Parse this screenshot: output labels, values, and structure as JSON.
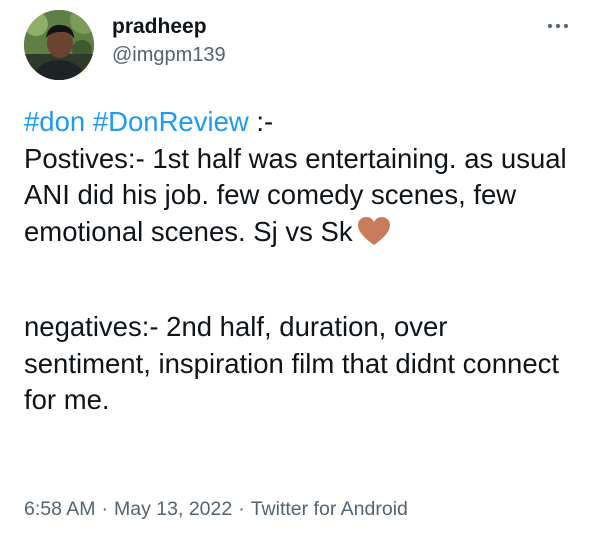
{
  "user": {
    "display_name": "pradheep",
    "handle": "@imgpm139",
    "avatar_icon": "user-photo"
  },
  "tweet": {
    "hashtags": [
      "#don",
      "#DonReview"
    ],
    "line1_suffix": " :-",
    "positives_text": "Postives:- 1st half was entertaining. as usual ANI did his job. few comedy scenes, few emotional scenes. Sj vs Sk",
    "heart_emoji_icon": "heart-icon",
    "heart_color": "#c97b5c",
    "negatives_text": "negatives:- 2nd half, duration, over sentiment, inspiration film that didnt connect for me."
  },
  "meta": {
    "time": "6:58 AM",
    "separator": "·",
    "date": "May 13, 2022",
    "source": "Twitter for Android"
  },
  "colors": {
    "link": "#1d9bf0",
    "secondary_text": "#536471",
    "primary_text": "#0f1419"
  }
}
